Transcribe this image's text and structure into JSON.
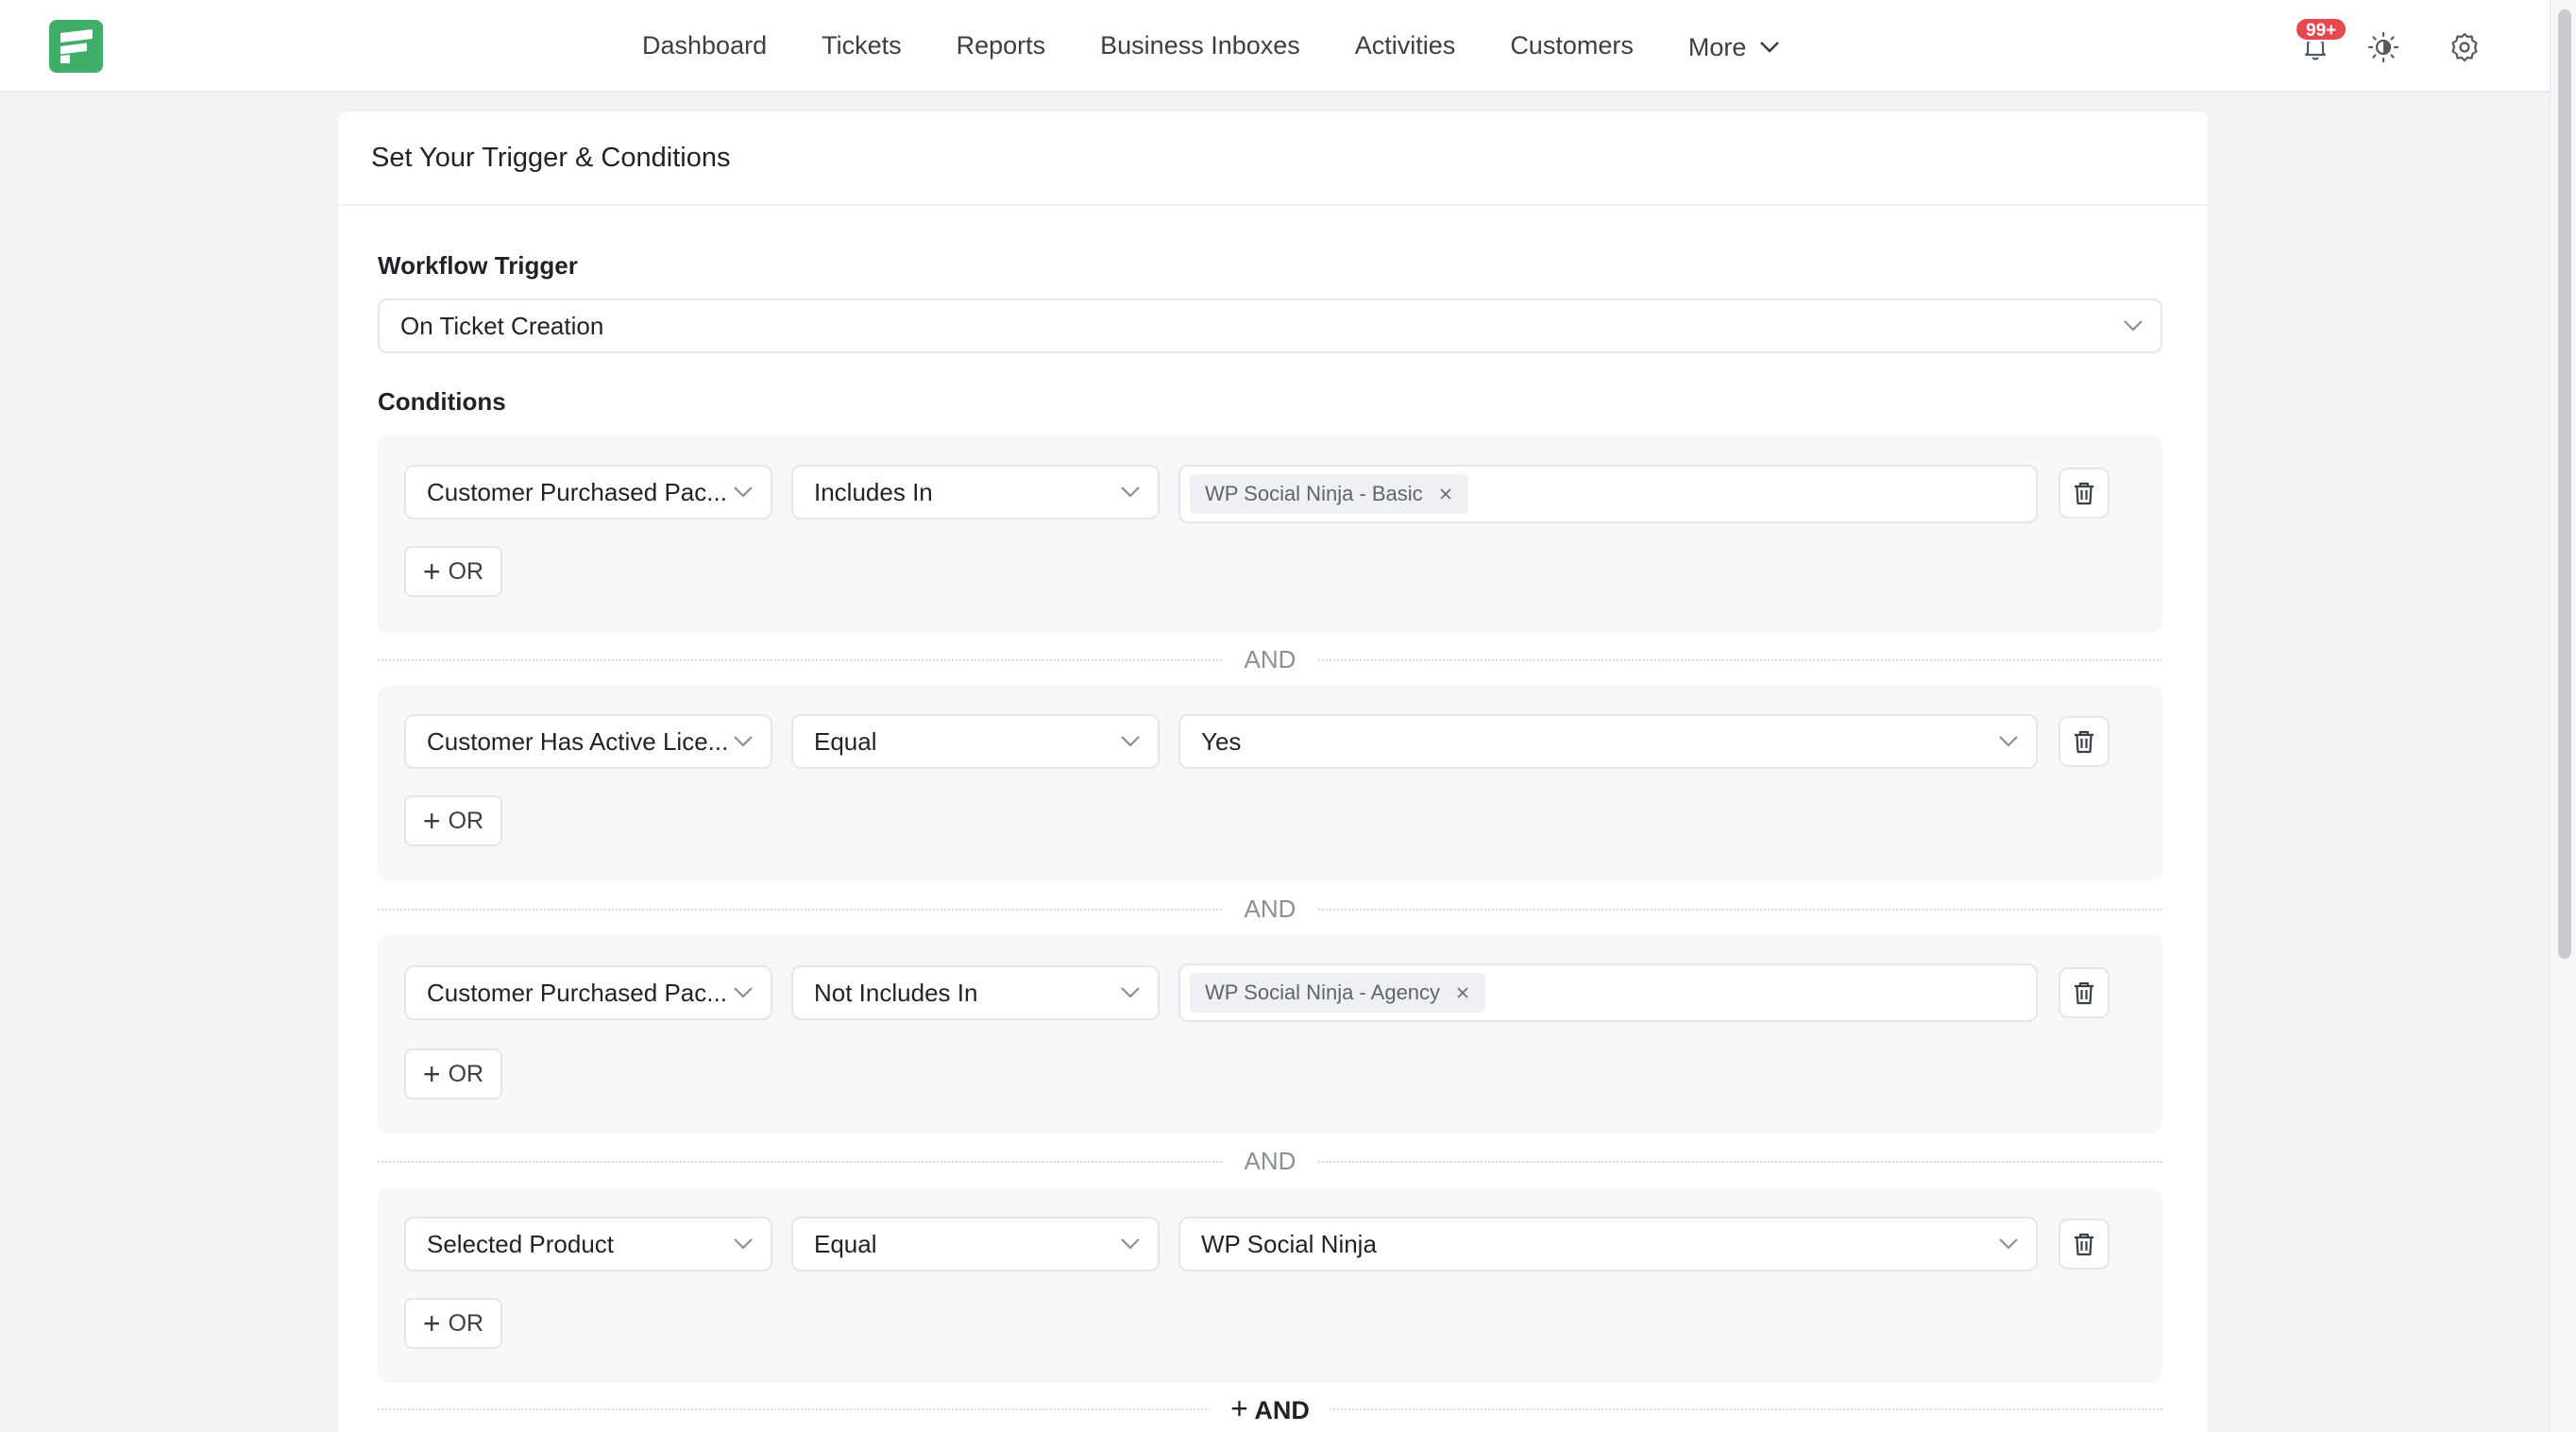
{
  "nav": {
    "items": [
      "Dashboard",
      "Tickets",
      "Reports",
      "Business Inboxes",
      "Activities",
      "Customers"
    ],
    "more": "More"
  },
  "header": {
    "notification_count": "99+",
    "icons": [
      "bell-icon",
      "theme-toggle-icon",
      "settings-icon"
    ]
  },
  "card": {
    "title": "Set Your Trigger & Conditions"
  },
  "trigger": {
    "label": "Workflow Trigger",
    "value": "On Ticket Creation"
  },
  "conditions": {
    "label": "Conditions",
    "groups": [
      {
        "field": "Customer Purchased Pac...",
        "operator": "Includes In",
        "tag": "WP Social Ninja - Basic",
        "or_label": "OR"
      },
      {
        "field": "Customer Has Active Lice...",
        "operator": "Equal",
        "value": "Yes",
        "or_label": "OR"
      },
      {
        "field": "Customer Purchased Pac...",
        "operator": "Not Includes In",
        "tag": "WP Social Ninja - Agency",
        "or_label": "OR"
      },
      {
        "field": "Selected Product",
        "operator": "Equal",
        "value": "WP Social Ninja",
        "or_label": "OR"
      }
    ],
    "and_label": "AND",
    "add_and_label": "AND"
  },
  "colors": {
    "brand": "#3fae6b",
    "badge": "#e5484d",
    "group_bg": "#f7f8fa"
  }
}
